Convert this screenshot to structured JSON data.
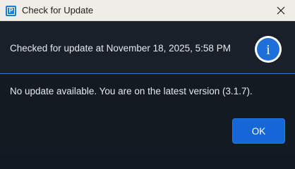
{
  "window": {
    "title": "Check for Update",
    "app_icon_letter": "P",
    "close_icon": "close-icon"
  },
  "header": {
    "text": "Checked for update at November 18, 2025, 5:58 PM",
    "icon": "info-icon",
    "icon_glyph": "i",
    "icon_color": "#1e6fd9"
  },
  "body": {
    "message": "No update available. You are on the latest version (3.1.7)."
  },
  "footer": {
    "ok_label": "OK"
  },
  "colors": {
    "accent": "#1566d6",
    "divider": "#3a78c9",
    "background": "#141a22"
  }
}
